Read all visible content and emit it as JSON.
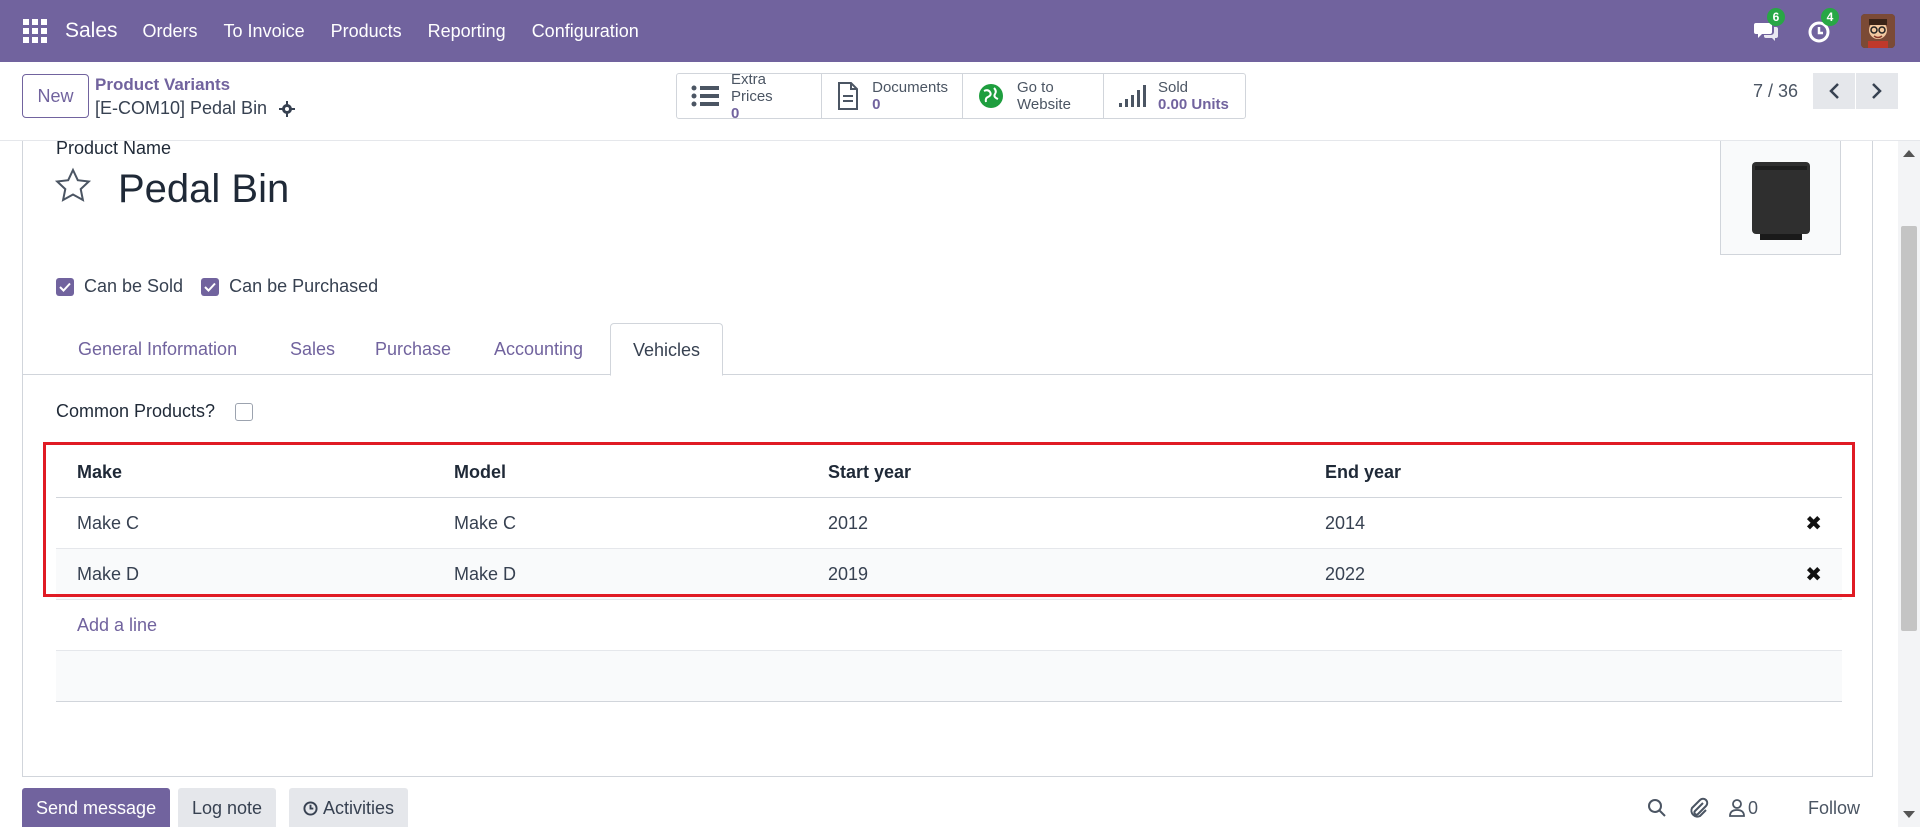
{
  "navbar": {
    "app_name": "Sales",
    "menu": [
      "Orders",
      "To Invoice",
      "Products",
      "Reporting",
      "Configuration"
    ],
    "messages_count": "6",
    "activities_count": "4"
  },
  "control": {
    "new_label": "New",
    "breadcrumb_parent": "Product Variants",
    "breadcrumb_current": "[E-COM10] Pedal Bin",
    "smart_buttons": [
      {
        "icon": "list-icon",
        "label": "Extra Prices",
        "value": "0"
      },
      {
        "icon": "document-icon",
        "label": "Documents",
        "value": "0"
      },
      {
        "icon": "globe-icon",
        "label": "Go to",
        "label2": "Website"
      },
      {
        "icon": "signal-icon",
        "label": "Sold",
        "value": "0.00 Units"
      }
    ],
    "pager": "7 / 36"
  },
  "form": {
    "product_name_label": "Product Name",
    "product_name": "Pedal Bin",
    "can_be_sold": "Can be Sold",
    "can_be_purchased": "Can be Purchased",
    "tabs": [
      "General Information",
      "Sales",
      "Purchase",
      "Accounting",
      "Vehicles"
    ],
    "active_tab": "Vehicles",
    "common_products_label": "Common Products?"
  },
  "vehicles_table": {
    "headers": [
      "Make",
      "Model",
      "Start year",
      "End year"
    ],
    "rows": [
      [
        "Make C",
        "Make C",
        "2012",
        "2014"
      ],
      [
        "Make D",
        "Make D",
        "2019",
        "2022"
      ]
    ],
    "add_line": "Add a line"
  },
  "chatter": {
    "send_message": "Send message",
    "log_note": "Log note",
    "activities": "Activities",
    "followers_count": "0",
    "follow": "Follow"
  },
  "colors": {
    "brand": "#71639e",
    "highlight": "#e01b24",
    "badge": "#28a745"
  }
}
